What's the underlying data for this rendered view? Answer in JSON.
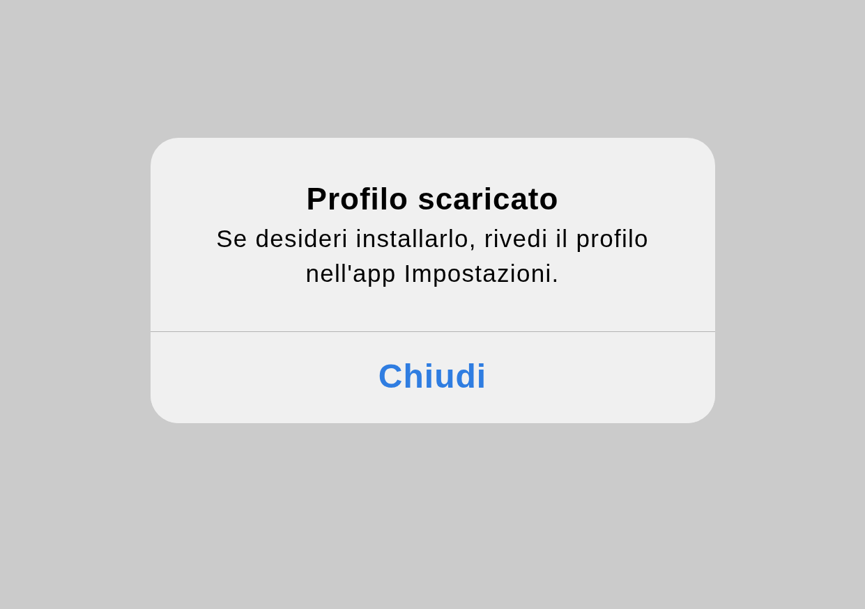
{
  "alert": {
    "title": "Profilo scaricato",
    "message": "Se desideri installarlo, rivedi il profilo nell'app Impostazioni.",
    "buttons": [
      {
        "label": "Chiudi"
      }
    ]
  }
}
